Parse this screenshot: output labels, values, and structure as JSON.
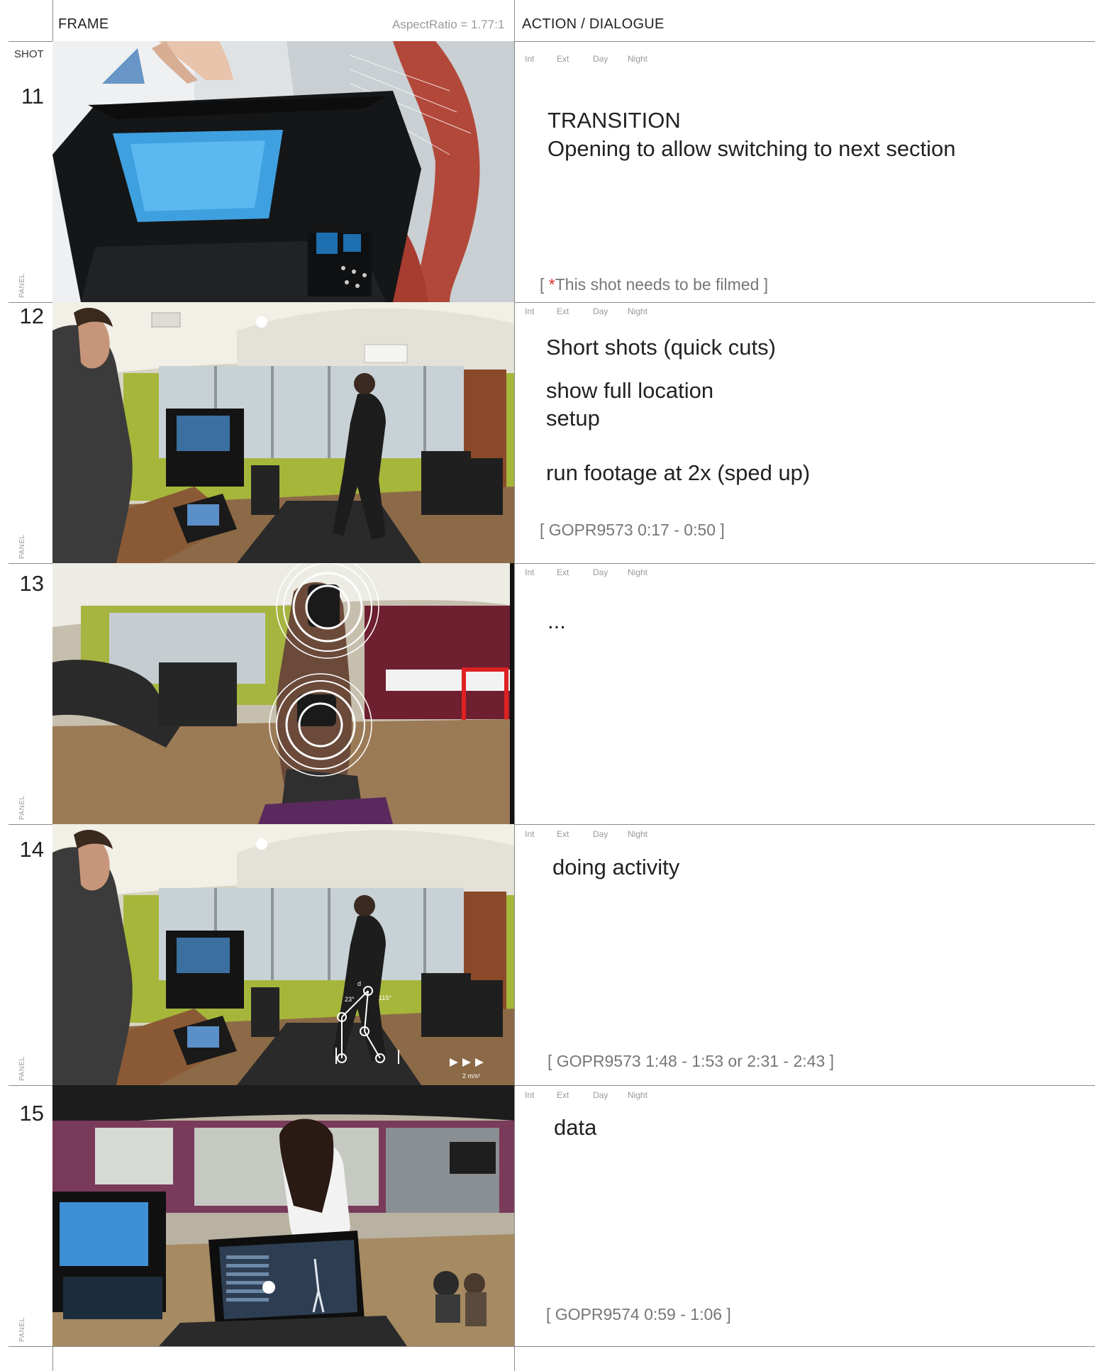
{
  "header": {
    "frame_label": "FRAME",
    "aspect_ratio": "AspectRatio = 1.77:1",
    "action_label": "ACTION",
    "dialogue_label": "/ DIALOGUE",
    "shot_label": "SHOT"
  },
  "tags": {
    "int": "Int",
    "ext": "Ext",
    "day": "Day",
    "night": "Night"
  },
  "panel_label": "PANEL",
  "shots": [
    {
      "number": "11",
      "lines": [
        "TRANSITION",
        "Opening to allow switching to next section"
      ],
      "note_open": "[ ",
      "note_star": "*",
      "note": "This shot needs to be filmed ]",
      "image": "open equipment case in front of anatomy muscle poster"
    },
    {
      "number": "12",
      "lines": [
        "Short shots (quick cuts)",
        "show full location",
        "setup",
        "run footage at 2x (sped up)"
      ],
      "note": "[ GOPR9573 0:17 - 0:50 ]",
      "image": "man at laptop, woman running on treadmill in gym"
    },
    {
      "number": "13",
      "lines": [
        "..."
      ],
      "note": "",
      "image": "close-up of leg with sensor, concentric circle highlights"
    },
    {
      "number": "14",
      "lines": [
        "doing activity"
      ],
      "note": "[ GOPR9573 1:48 - 1:53 or 2:31 - 2:43 ]",
      "image": "treadmill runner with biomechanics overlay",
      "overlay_text": {
        "angle1": "23°",
        "angle2": "115°",
        "d": "d",
        "speed": "2 m/s²"
      }
    },
    {
      "number": "15",
      "lines": [
        "data"
      ],
      "note": "[ GOPR9574 0:59 - 1:06 ]",
      "image": "laptop showing data, woman walking in clinic"
    }
  ],
  "colors": {
    "rule": "#8a8a8a",
    "accent_star": "#d62b2b",
    "screen_blue": "#3fa0e0"
  }
}
